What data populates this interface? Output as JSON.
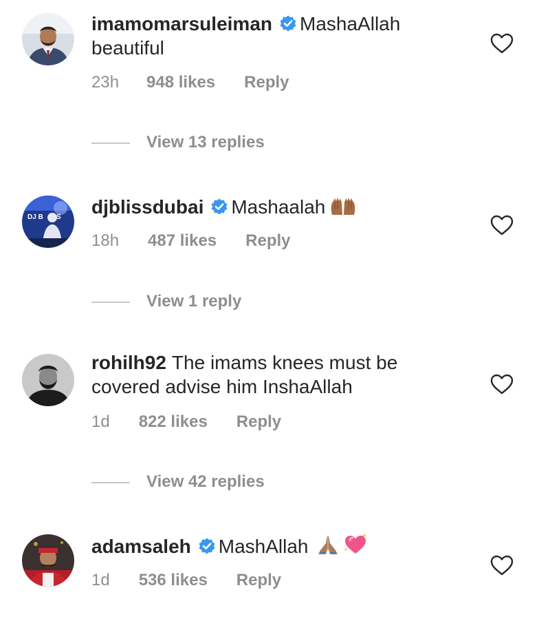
{
  "comments": [
    {
      "username": "imamomarsuleiman",
      "verified": true,
      "text": "MashaAllah beautiful",
      "time": "23h",
      "likes": "948 likes",
      "reply_label": "Reply",
      "view_replies": "View 13 replies",
      "avatar_icon": "avatar-photo"
    },
    {
      "username": "djblissdubai",
      "verified": true,
      "text": "Mashaalah",
      "emojis": [
        "raised-hands-icon"
      ],
      "time": "18h",
      "likes": "487 likes",
      "reply_label": "Reply",
      "view_replies": "View 1 reply",
      "avatar_icon": "avatar-photo"
    },
    {
      "username": "rohilh92",
      "verified": false,
      "text": "The imams knees must be covered advise him InshaAllah",
      "time": "1d",
      "likes": "822 likes",
      "reply_label": "Reply",
      "view_replies": "View 42 replies",
      "avatar_icon": "avatar-photo"
    },
    {
      "username": "adamsaleh",
      "verified": true,
      "text": "MashAllah",
      "emojis": [
        "folded-hands-icon",
        "sparkling-heart-icon"
      ],
      "time": "1d",
      "likes": "536 likes",
      "reply_label": "Reply",
      "avatar_icon": "avatar-photo"
    }
  ],
  "colors": {
    "text": "#262626",
    "meta": "#8e8e8e",
    "verified": "#3897f0",
    "divider": "#c7c7c7"
  }
}
